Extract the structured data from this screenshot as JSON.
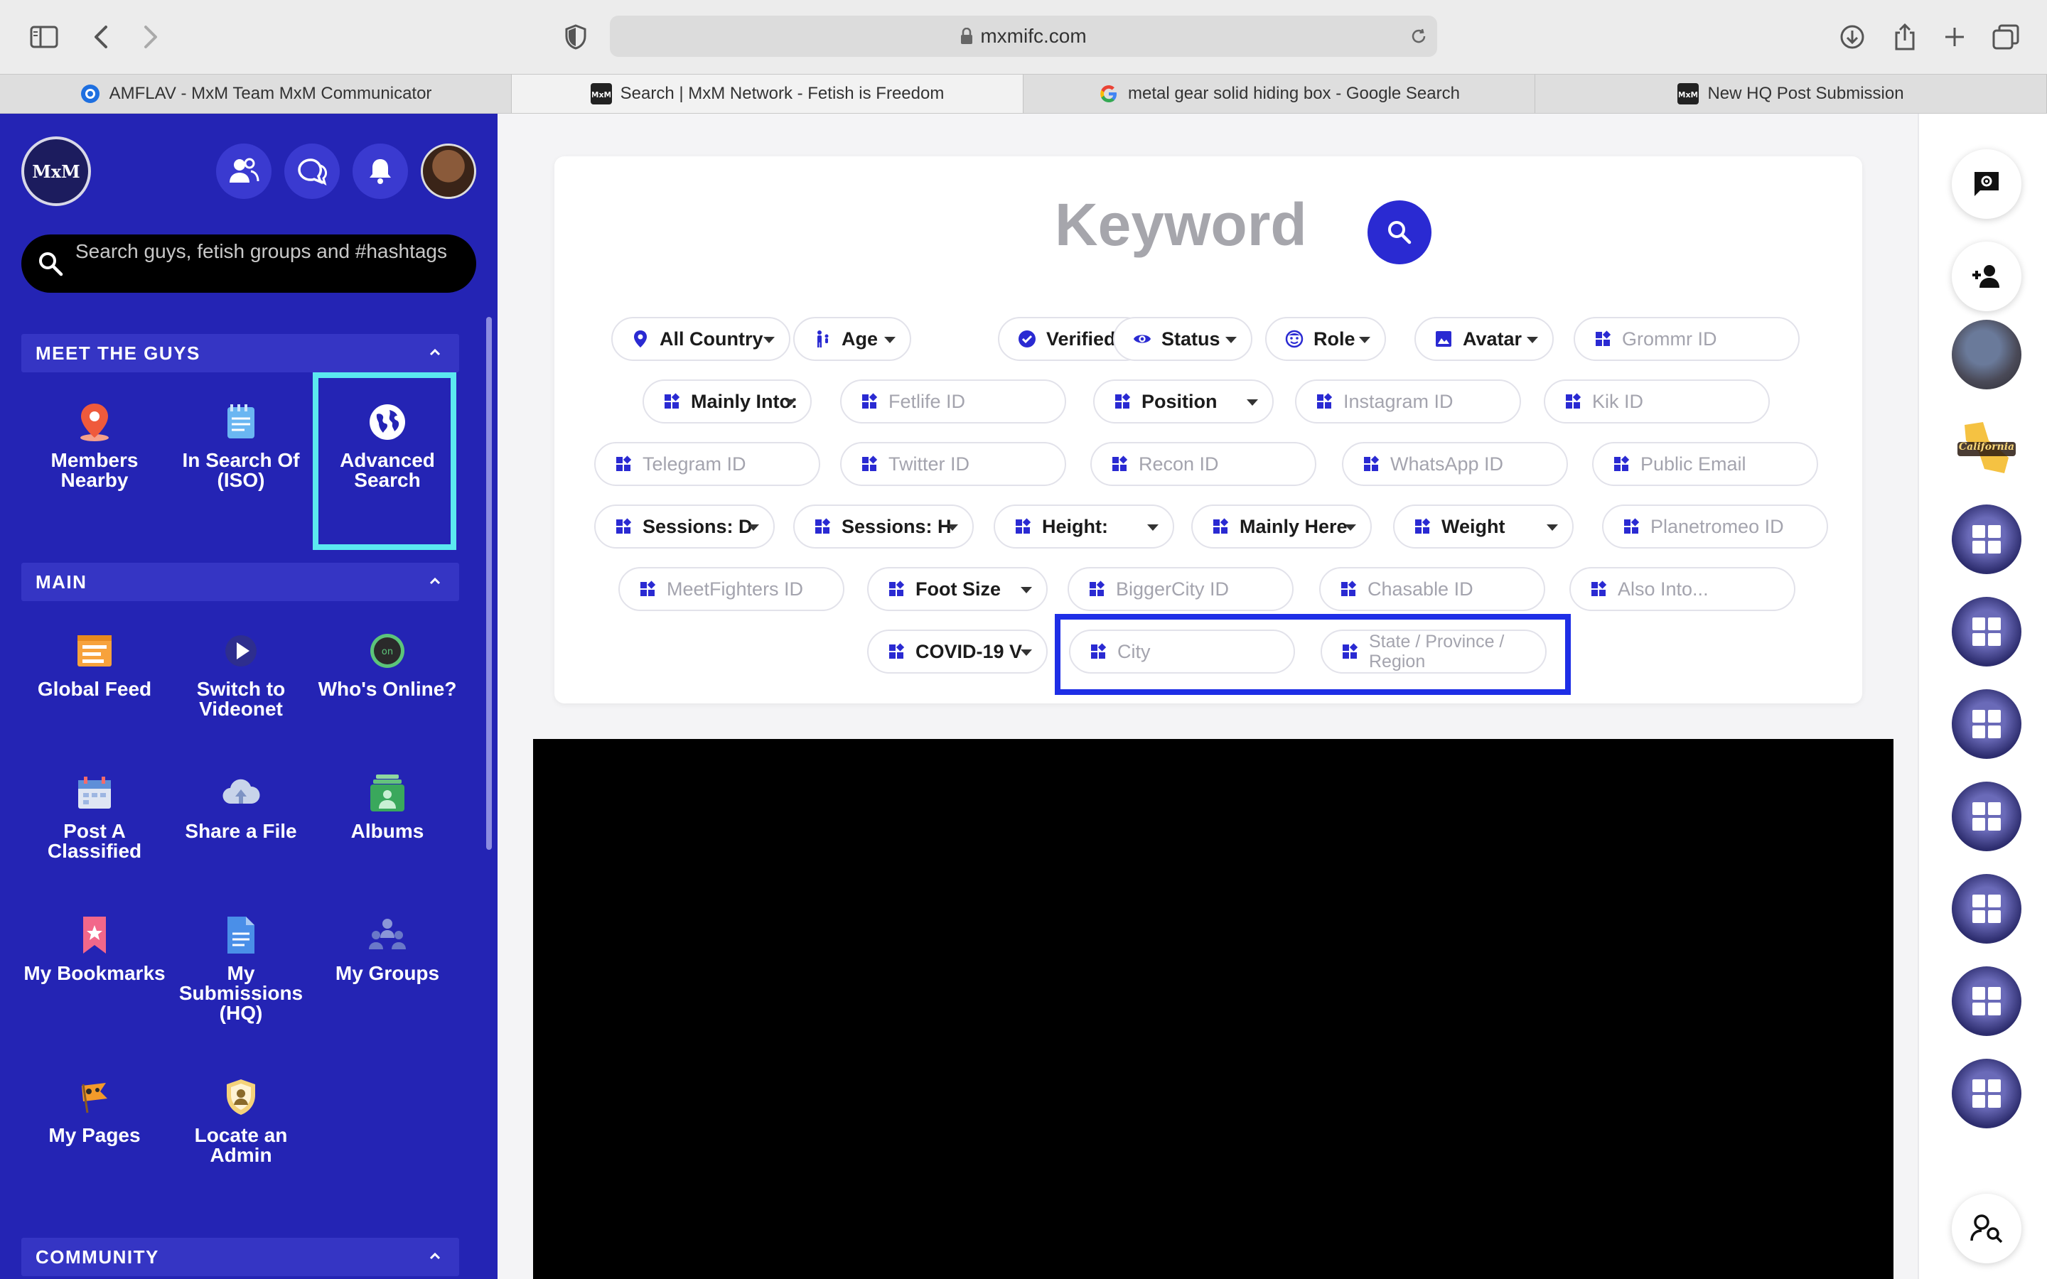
{
  "browser": {
    "url": "mxmifc.com",
    "tabs": [
      {
        "title": "AMFLAV - MxM Team MxM Communicator",
        "favicon": "blue-circle-icon"
      },
      {
        "title": "Search | MxM Network - Fetish is Freedom",
        "favicon": "mxm-logo-icon"
      },
      {
        "title": "metal gear solid hiding box - Google Search",
        "favicon": "google-g-icon"
      },
      {
        "title": "New HQ Post Submission",
        "favicon": "mxm-logo-icon"
      }
    ]
  },
  "sidebar": {
    "logo_text": "MxM",
    "search_placeholder": "Search guys, fetish groups and #hashtags",
    "sections": {
      "meet": {
        "title": "MEET THE GUYS",
        "items": [
          {
            "label": "Members\nNearby",
            "icon": "map-pin-icon"
          },
          {
            "label": "In Search Of\n(ISO)",
            "icon": "notepad-icon"
          },
          {
            "label": "Advanced\nSearch",
            "icon": "globe-icon"
          }
        ]
      },
      "main": {
        "title": "MAIN",
        "items": [
          {
            "label": "Global Feed",
            "icon": "feed-icon"
          },
          {
            "label": "Switch to\nVideonet",
            "icon": "video-play-icon"
          },
          {
            "label": "Who's Online?",
            "icon": "online-icon"
          },
          {
            "label": "Post A\nClassified",
            "icon": "calendar-icon"
          },
          {
            "label": "Share a File",
            "icon": "cloud-upload-icon"
          },
          {
            "label": "Albums",
            "icon": "albums-icon"
          },
          {
            "label": "My Bookmarks",
            "icon": "bookmark-icon"
          },
          {
            "label": "My\nSubmissions\n(HQ)",
            "icon": "document-icon"
          },
          {
            "label": "My Groups",
            "icon": "groups-icon"
          },
          {
            "label": "My Pages",
            "icon": "flag-icon"
          },
          {
            "label": "Locate an\nAdmin",
            "icon": "admin-badge-icon"
          }
        ]
      },
      "community": {
        "title": "COMMUNITY"
      }
    }
  },
  "search": {
    "keyword_label": "Keyword",
    "rows": [
      [
        {
          "label": "All Country",
          "type": "dropdown",
          "icon": "pin"
        },
        {
          "label": "Age",
          "type": "dropdown",
          "icon": "person"
        },
        {
          "label": "Verified",
          "type": "dropdown",
          "icon": "check"
        },
        {
          "label": "Status",
          "type": "dropdown",
          "icon": "eye"
        },
        {
          "label": "Role",
          "type": "dropdown",
          "icon": "face"
        },
        {
          "label": "Avatar",
          "type": "dropdown",
          "icon": "image"
        },
        {
          "label": "Grommr ID",
          "type": "input",
          "icon": "widget"
        }
      ],
      [
        {
          "label": "Mainly Into:",
          "type": "dropdown",
          "icon": "widget"
        },
        {
          "label": "Fetlife ID",
          "type": "input",
          "icon": "widget"
        },
        {
          "label": "Position",
          "type": "dropdown",
          "icon": "widget"
        },
        {
          "label": "Instagram ID",
          "type": "input",
          "icon": "widget"
        },
        {
          "label": "Kik ID",
          "type": "input",
          "icon": "widget"
        }
      ],
      [
        {
          "label": "Telegram ID",
          "type": "input",
          "icon": "widget"
        },
        {
          "label": "Twitter ID",
          "type": "input",
          "icon": "widget"
        },
        {
          "label": "Recon ID",
          "type": "input",
          "icon": "widget"
        },
        {
          "label": "WhatsApp ID",
          "type": "input",
          "icon": "widget"
        },
        {
          "label": "Public Email",
          "type": "input",
          "icon": "widget"
        }
      ],
      [
        {
          "label": "Sessions: D",
          "type": "dropdown",
          "icon": "widget"
        },
        {
          "label": "Sessions: H",
          "type": "dropdown",
          "icon": "widget"
        },
        {
          "label": "Height:",
          "type": "dropdown",
          "icon": "widget"
        },
        {
          "label": "Mainly Here",
          "type": "dropdown",
          "icon": "widget"
        },
        {
          "label": "Weight",
          "type": "dropdown",
          "icon": "widget"
        },
        {
          "label": "Planetromeo ID",
          "type": "input",
          "icon": "widget"
        }
      ],
      [
        {
          "label": "MeetFighters ID",
          "type": "input",
          "icon": "widget"
        },
        {
          "label": "Foot Size",
          "type": "dropdown",
          "icon": "widget"
        },
        {
          "label": "BiggerCity ID",
          "type": "input",
          "icon": "widget"
        },
        {
          "label": "Chasable ID",
          "type": "input",
          "icon": "widget"
        },
        {
          "label": "Also Into...",
          "type": "input",
          "icon": "widget"
        }
      ],
      [
        {
          "label": "COVID-19 V",
          "type": "dropdown",
          "icon": "widget"
        },
        {
          "label": "City",
          "type": "input",
          "icon": "widget"
        },
        {
          "label": "State / Province / Region",
          "type": "input",
          "icon": "widget"
        }
      ]
    ]
  },
  "rail": {
    "buttons": [
      "settings-chat-icon",
      "add-friend-icon",
      "user-search-icon"
    ],
    "avatar_location_label": "California"
  },
  "colors": {
    "sidebar_bg": "#2424b4",
    "accent": "#2a2ad2",
    "highlight_cyan": "#5be8f0",
    "highlight_blue": "#1e2ee6"
  }
}
